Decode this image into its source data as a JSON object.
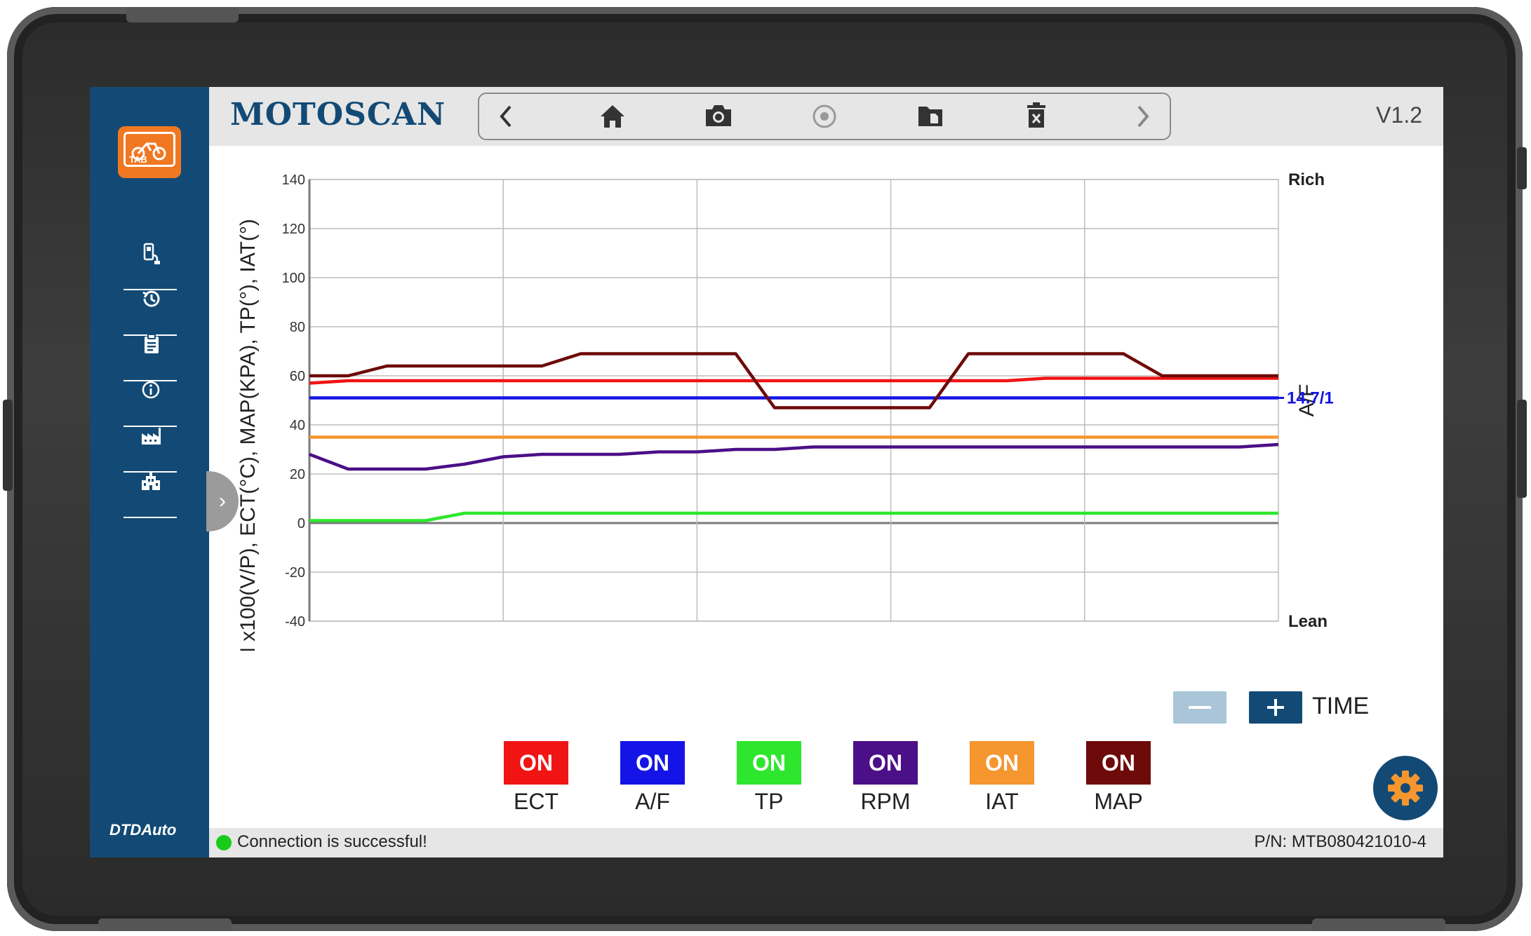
{
  "app": {
    "title": "MOTOSCAN",
    "version": "V1.2",
    "brand": "DTDAuto",
    "sidebar_tab_label": "TAB"
  },
  "toolbar": {
    "buttons": [
      {
        "name": "back-icon"
      },
      {
        "name": "home-icon"
      },
      {
        "name": "camera-icon"
      },
      {
        "name": "record-icon"
      },
      {
        "name": "file-icon"
      },
      {
        "name": "delete-icon"
      },
      {
        "name": "forward-icon"
      }
    ]
  },
  "sidebar": {
    "items": [
      {
        "name": "diagnostics-icon"
      },
      {
        "name": "history-icon"
      },
      {
        "name": "report-icon"
      },
      {
        "name": "info-icon"
      },
      {
        "name": "factory-icon"
      },
      {
        "name": "building-icon"
      }
    ]
  },
  "chart_data": {
    "type": "line",
    "ylabel": "RPM x100(V/P), ECT(°C), MAP(KPA), TP(°), IAT(°)",
    "y2label": "A/F",
    "ylim": [
      -40,
      140
    ],
    "yticks": [
      140,
      120,
      100,
      80,
      60,
      40,
      20,
      0,
      -20,
      -40
    ],
    "right_labels": {
      "top": "Rich",
      "bottom": "Lean",
      "reference": "14.7/1",
      "reference_value": 51
    },
    "grid": true,
    "x": [
      0,
      1,
      2,
      3,
      4,
      5,
      6,
      7,
      8,
      9,
      10,
      11,
      12,
      13,
      14,
      15,
      16,
      17,
      18,
      19,
      20,
      21,
      22,
      23,
      24,
      25
    ],
    "series": [
      {
        "name": "ECT",
        "color": "#f01414",
        "values": [
          57,
          58,
          58,
          58,
          58,
          58,
          58,
          58,
          58,
          58,
          58,
          58,
          58,
          58,
          58,
          58,
          58,
          58,
          58,
          59,
          59,
          59,
          59,
          59,
          59,
          59
        ]
      },
      {
        "name": "A/F",
        "color": "#1414e6",
        "values": [
          51,
          51,
          51,
          51,
          51,
          51,
          51,
          51,
          51,
          51,
          51,
          51,
          51,
          51,
          51,
          51,
          51,
          51,
          51,
          51,
          51,
          51,
          51,
          51,
          51,
          51
        ]
      },
      {
        "name": "TP",
        "color": "#2ee62e",
        "values": [
          1,
          1,
          1,
          1,
          4,
          4,
          4,
          4,
          4,
          4,
          4,
          4,
          4,
          4,
          4,
          4,
          4,
          4,
          4,
          4,
          4,
          4,
          4,
          4,
          4,
          4
        ]
      },
      {
        "name": "RPM",
        "color": "#4b0f87",
        "values": [
          28,
          22,
          22,
          22,
          24,
          27,
          28,
          28,
          28,
          29,
          29,
          30,
          30,
          31,
          31,
          31,
          31,
          31,
          31,
          31,
          31,
          31,
          31,
          31,
          31,
          32
        ]
      },
      {
        "name": "IAT",
        "color": "#f5962e",
        "values": [
          35,
          35,
          35,
          35,
          35,
          35,
          35,
          35,
          35,
          35,
          35,
          35,
          35,
          35,
          35,
          35,
          35,
          35,
          35,
          35,
          35,
          35,
          35,
          35,
          35,
          35
        ]
      },
      {
        "name": "MAP",
        "color": "#6e0a0a",
        "values": [
          60,
          60,
          64,
          64,
          64,
          64,
          64,
          69,
          69,
          69,
          69,
          69,
          47,
          47,
          47,
          47,
          47,
          69,
          69,
          69,
          69,
          69,
          60,
          60,
          60,
          60
        ]
      }
    ]
  },
  "controls": {
    "time_label": "TIME"
  },
  "toggles": [
    {
      "state": "ON",
      "label": "ECT",
      "color": "#f01414"
    },
    {
      "state": "ON",
      "label": "A/F",
      "color": "#1414e6"
    },
    {
      "state": "ON",
      "label": "TP",
      "color": "#2ee62e"
    },
    {
      "state": "ON",
      "label": "RPM",
      "color": "#4b0f87"
    },
    {
      "state": "ON",
      "label": "IAT",
      "color": "#f5962e"
    },
    {
      "state": "ON",
      "label": "MAP",
      "color": "#6e0a0a"
    }
  ],
  "status": {
    "message": "Connection is successful!",
    "part_number": "P/N: MTB080421010-4"
  }
}
